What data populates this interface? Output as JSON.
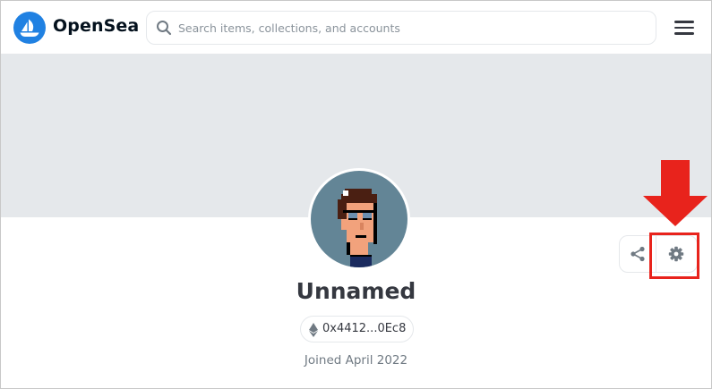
{
  "header": {
    "brand": "OpenSea",
    "search_placeholder": "Search items, collections, and accounts"
  },
  "profile": {
    "name": "Unnamed",
    "address": "0x4412...0Ec8",
    "joined": "Joined April 2022"
  },
  "icons": {
    "logo": "opensea-logo-icon",
    "search": "search-icon",
    "menu": "hamburger-menu-icon",
    "share": "share-icon",
    "settings": "gear-icon",
    "ethereum": "ethereum-icon",
    "annotation": "red-arrow-down"
  },
  "colors": {
    "brand_blue": "#2081e2",
    "banner": "#e5e8eb",
    "avatar_bg": "#638596",
    "annotation_red": "#e8231c",
    "text_dark": "#353840",
    "text_muted": "#707a83"
  }
}
